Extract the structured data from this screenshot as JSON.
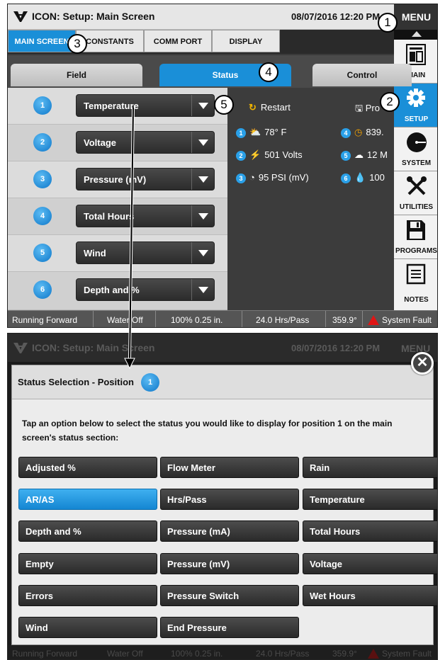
{
  "top": {
    "title": "ICON: Setup: Main Screen",
    "datetime": "08/07/2016 12:20 PM",
    "menu_label": "MENU",
    "tabs": [
      "MAIN SCREEN",
      "CONSTANTS",
      "COMM PORT",
      "DISPLAY"
    ],
    "subtabs": [
      "Field",
      "Status",
      "Control"
    ],
    "sidebar": [
      {
        "label": "MAIN",
        "icon": "main-screen-icon"
      },
      {
        "label": "SETUP",
        "icon": "gear-icon"
      },
      {
        "label": "SYSTEM",
        "icon": "system-icon"
      },
      {
        "label": "UTILITIES",
        "icon": "tools-icon"
      },
      {
        "label": "PROGRAMS",
        "icon": "floppy-disk-icon"
      },
      {
        "label": "NOTES",
        "icon": "notes-icon"
      }
    ],
    "positions": [
      {
        "num": "1",
        "value": "Temperature"
      },
      {
        "num": "2",
        "value": "Voltage"
      },
      {
        "num": "3",
        "value": "Pressure (mV)"
      },
      {
        "num": "4",
        "value": "Total Hours"
      },
      {
        "num": "5",
        "value": "Wind"
      },
      {
        "num": "6",
        "value": "Depth and %"
      }
    ],
    "status_panel": {
      "restart": "Restart",
      "programs": "Pro",
      "items": [
        {
          "num": "1",
          "icon": "sun-cloud-icon",
          "text": "78° F"
        },
        {
          "num": "2",
          "icon": "lightning-icon",
          "text": "501 Volts"
        },
        {
          "num": "3",
          "icon": "gauge-icon",
          "text": "95 PSI (mV)"
        },
        {
          "num": "4",
          "icon": "clock-icon",
          "text": "839."
        },
        {
          "num": "5",
          "icon": "wind-icon",
          "text": "12 M"
        },
        {
          "num": "6",
          "icon": "water-drop-icon",
          "text": "100"
        }
      ]
    },
    "statusbar": [
      "Running Forward",
      "Water Off",
      "100%  0.25 in.",
      "24.0 Hrs/Pass",
      "359.9°",
      "System Fault"
    ]
  },
  "callouts": [
    "1",
    "2",
    "3",
    "4",
    "5"
  ],
  "bottom": {
    "title": "ICON: Setup: Main Screen",
    "datetime": "08/07/2016 12:20 PM",
    "menu_label": "MENU",
    "dialog_title": "Status Selection - Position",
    "dialog_position": "1",
    "description": "Tap an option below to select the status you would like to display for position 1 on the main screen's status section:",
    "options": [
      [
        "Adjusted %",
        "Flow Meter",
        "Rain"
      ],
      [
        "AR/AS",
        "Hrs/Pass",
        "Temperature"
      ],
      [
        "Depth and %",
        "Pressure (mA)",
        "Total Hours"
      ],
      [
        "Empty",
        "Pressure (mV)",
        "Voltage"
      ],
      [
        "Errors",
        "Pressure Switch",
        "Wet Hours"
      ],
      [
        "Wind",
        "End Pressure"
      ]
    ],
    "selected_option": "AR/AS",
    "statusbar": [
      "Running Forward",
      "Water Off",
      "100%  0.25 in.",
      "24.0 Hrs/Pass",
      "359.9°",
      "System Fault"
    ]
  },
  "colors": {
    "accent": "#1a8fd8",
    "fault": "#e01515"
  }
}
